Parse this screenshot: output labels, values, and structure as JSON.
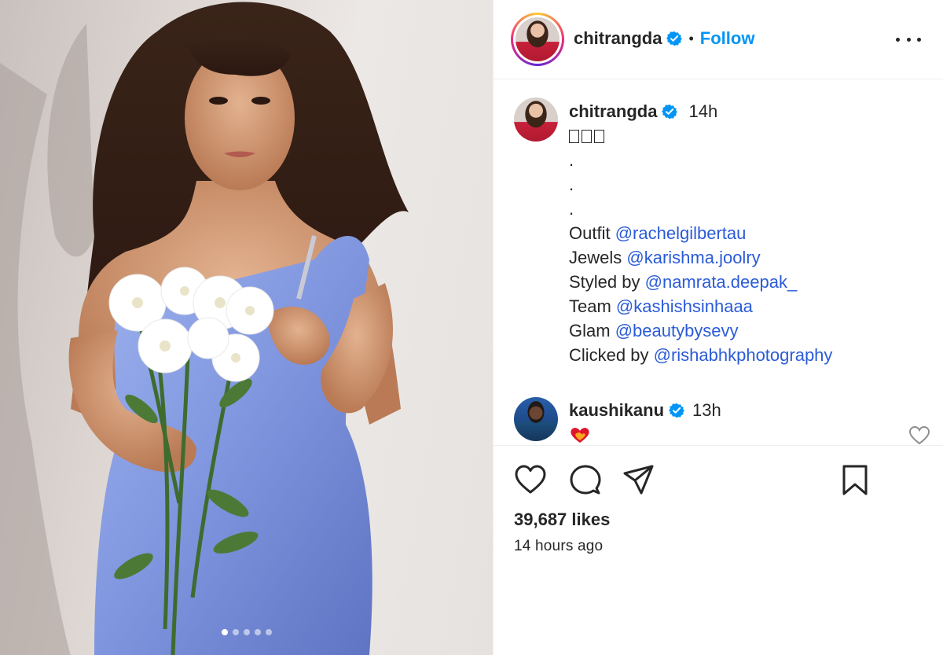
{
  "post": {
    "media_alt": "Woman in blue satin dress holding white flowers",
    "carousel_total": 5,
    "carousel_active": 1
  },
  "header": {
    "username": "chitrangda",
    "separator": "•",
    "follow_label": "Follow"
  },
  "caption": {
    "username": "chitrangda",
    "time": "14h",
    "emoji_boxes": 3,
    "dots": [
      ".",
      ".",
      "."
    ],
    "credits": [
      {
        "label": "Outfit",
        "mention": "@rachelgilbertau"
      },
      {
        "label": "Jewels",
        "mention": "@karishma.joolry"
      },
      {
        "label": "Styled by",
        "mention": "@namrata.deepak_"
      },
      {
        "label": "Team",
        "mention": "@kashishsinhaaa"
      },
      {
        "label": "Glam",
        "mention": "@beautybysevy"
      },
      {
        "label": "Clicked by",
        "mention": "@rishabhkphotography"
      }
    ]
  },
  "comment": {
    "username": "kaushikanu",
    "time": "13h",
    "emoji": "heart-on-fire"
  },
  "stats": {
    "likes": "39,687 likes",
    "posted_ago": "14 hours ago"
  },
  "colors": {
    "link": "#0095f6",
    "mention": "#2a5bd7",
    "verified": "#0095f6",
    "text": "#262626"
  }
}
